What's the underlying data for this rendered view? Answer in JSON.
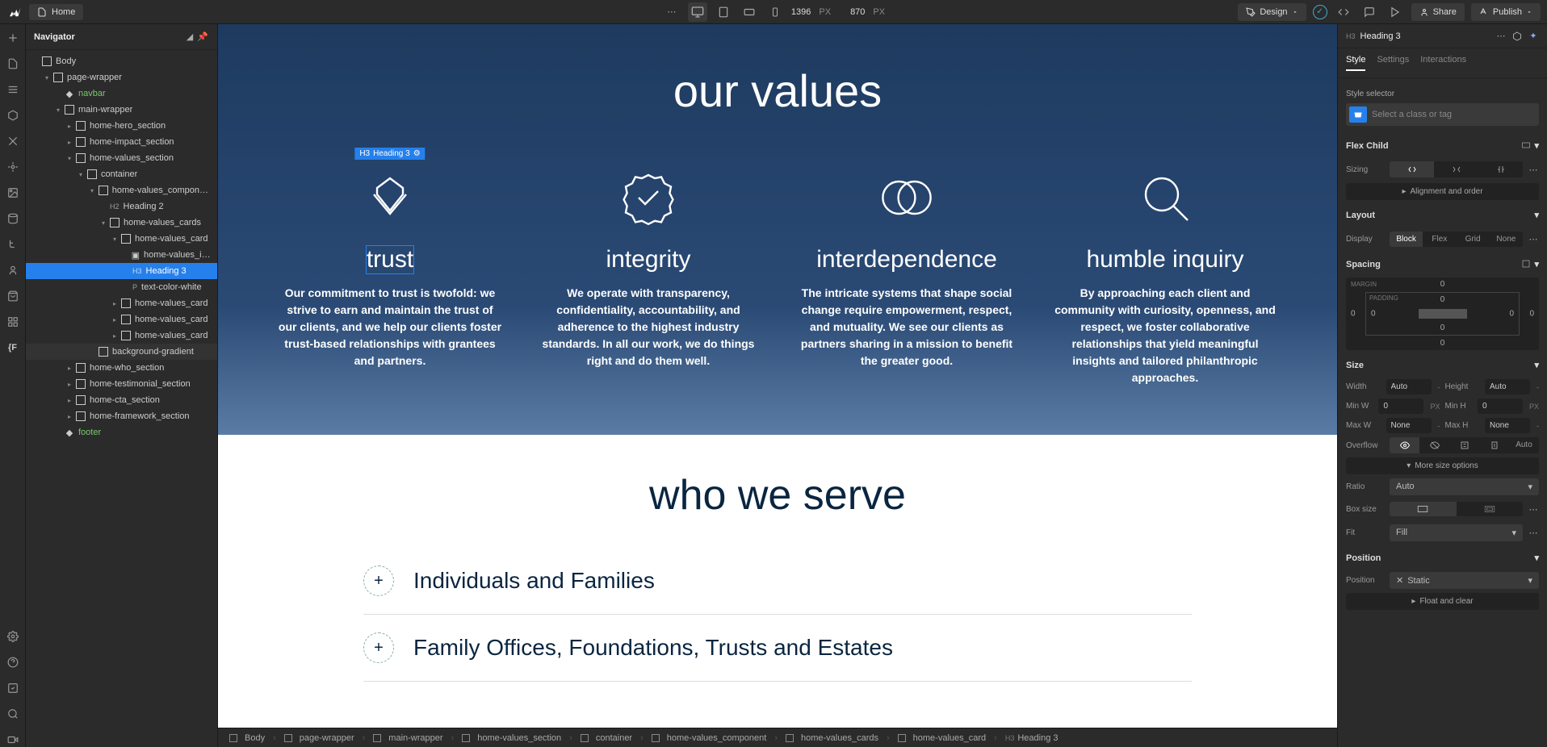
{
  "topbar": {
    "page_name": "Home",
    "canvas_w": "1396",
    "canvas_h": "870",
    "px_label": "PX",
    "design_label": "Design",
    "share_label": "Share",
    "publish_label": "Publish"
  },
  "navigator": {
    "title": "Navigator",
    "tree": [
      {
        "indent": 0,
        "chev": "",
        "icon": "box",
        "label": "Body"
      },
      {
        "indent": 1,
        "chev": "▾",
        "icon": "box",
        "label": "page-wrapper"
      },
      {
        "indent": 2,
        "chev": "",
        "icon": "comp",
        "label": "navbar",
        "green": true
      },
      {
        "indent": 2,
        "chev": "▾",
        "icon": "box",
        "label": "main-wrapper"
      },
      {
        "indent": 3,
        "chev": "▸",
        "icon": "box",
        "label": "home-hero_section"
      },
      {
        "indent": 3,
        "chev": "▸",
        "icon": "box",
        "label": "home-impact_section"
      },
      {
        "indent": 3,
        "chev": "▾",
        "icon": "box",
        "label": "home-values_section"
      },
      {
        "indent": 4,
        "chev": "▾",
        "icon": "box",
        "label": "container"
      },
      {
        "indent": 5,
        "chev": "▾",
        "icon": "box",
        "label": "home-values_component"
      },
      {
        "indent": 6,
        "chev": "",
        "icon": "",
        "tag": "H2",
        "label": "Heading 2"
      },
      {
        "indent": 6,
        "chev": "▾",
        "icon": "box",
        "label": "home-values_cards"
      },
      {
        "indent": 7,
        "chev": "▾",
        "icon": "box",
        "label": "home-values_card"
      },
      {
        "indent": 8,
        "chev": "",
        "icon": "img",
        "label": "home-values_ima..."
      },
      {
        "indent": 8,
        "chev": "",
        "icon": "",
        "tag": "H3",
        "label": "Heading 3",
        "selected": true
      },
      {
        "indent": 8,
        "chev": "",
        "icon": "",
        "tag": "P",
        "label": "text-color-white"
      },
      {
        "indent": 7,
        "chev": "▸",
        "icon": "box",
        "label": "home-values_card"
      },
      {
        "indent": 7,
        "chev": "▸",
        "icon": "box",
        "label": "home-values_card"
      },
      {
        "indent": 7,
        "chev": "▸",
        "icon": "box",
        "label": "home-values_card"
      },
      {
        "indent": 5,
        "chev": "",
        "icon": "box",
        "label": "background-gradient",
        "hover": true
      },
      {
        "indent": 3,
        "chev": "▸",
        "icon": "box",
        "label": "home-who_section"
      },
      {
        "indent": 3,
        "chev": "▸",
        "icon": "box",
        "label": "home-testimonial_section"
      },
      {
        "indent": 3,
        "chev": "▸",
        "icon": "box",
        "label": "home-cta_section"
      },
      {
        "indent": 3,
        "chev": "▸",
        "icon": "box",
        "label": "home-framework_section"
      },
      {
        "indent": 2,
        "chev": "",
        "icon": "comp",
        "label": "footer",
        "green": true
      }
    ]
  },
  "canvas": {
    "selection_badge_tag": "H3",
    "selection_badge_label": "Heading 3",
    "values_title": "our values",
    "values": [
      {
        "heading": "trust",
        "text": "Our commitment to trust is twofold: we strive to earn and maintain the trust of our clients, and we help our clients foster trust-based relationships with grantees and partners."
      },
      {
        "heading": "integrity",
        "text": "We operate with transparency, confidentiality, accountability, and adherence to the highest industry standards. In all our work, we do things right and do them well."
      },
      {
        "heading": "interdependence",
        "text": "The intricate systems that shape social change require empowerment, respect, and mutuality. We see our clients as partners sharing in a mission to benefit the greater good."
      },
      {
        "heading": "humble inquiry",
        "text": "By approaching each client and community with curiosity, openness, and respect, we foster collaborative relationships that yield meaningful insights and tailored philanthropic approaches."
      }
    ],
    "who_title": "who we serve",
    "who_items": [
      "Individuals and Families",
      "Family Offices, Foundations, Trusts and Estates"
    ]
  },
  "breadcrumbs": [
    "Body",
    "page-wrapper",
    "main-wrapper",
    "home-values_section",
    "container",
    "home-values_component",
    "home-values_cards",
    "home-values_card",
    "Heading 3"
  ],
  "breadcrumb_tags": [
    "",
    "",
    "",
    "",
    "",
    "",
    "",
    "",
    "H3"
  ],
  "inspector": {
    "element_tag": "H3",
    "element_label": "Heading 3",
    "tabs": [
      "Style",
      "Settings",
      "Interactions"
    ],
    "style_selector_label": "Style selector",
    "class_placeholder": "Select a class or tag",
    "flex_child_label": "Flex Child",
    "sizing_label": "Sizing",
    "alignment_label": "Alignment and order",
    "layout_label": "Layout",
    "display_label": "Display",
    "display_options": [
      "Block",
      "Flex",
      "Grid",
      "None"
    ],
    "spacing_label": "Spacing",
    "margin_label": "MARGIN",
    "padding_label": "PADDING",
    "spacing_values": {
      "m_top": "0",
      "m_right": "0",
      "m_bottom": "0",
      "m_left": "0",
      "p_top": "0",
      "p_right": "0",
      "p_bottom": "0",
      "p_left": "0"
    },
    "size_label": "Size",
    "width_label": "Width",
    "width_val": "Auto",
    "height_label": "Height",
    "height_val": "Auto",
    "minw_label": "Min W",
    "minw_val": "0",
    "minh_label": "Min H",
    "minh_val": "0",
    "maxw_label": "Max W",
    "maxw_val": "None",
    "maxh_label": "Max H",
    "maxh_val": "None",
    "overflow_label": "Overflow",
    "overflow_auto": "Auto",
    "more_size_label": "More size options",
    "ratio_label": "Ratio",
    "ratio_val": "Auto",
    "boxsize_label": "Box size",
    "fit_label": "Fit",
    "fit_val": "Fill",
    "position_panel_label": "Position",
    "position_label": "Position",
    "position_val": "Static",
    "float_label": "Float and clear"
  }
}
